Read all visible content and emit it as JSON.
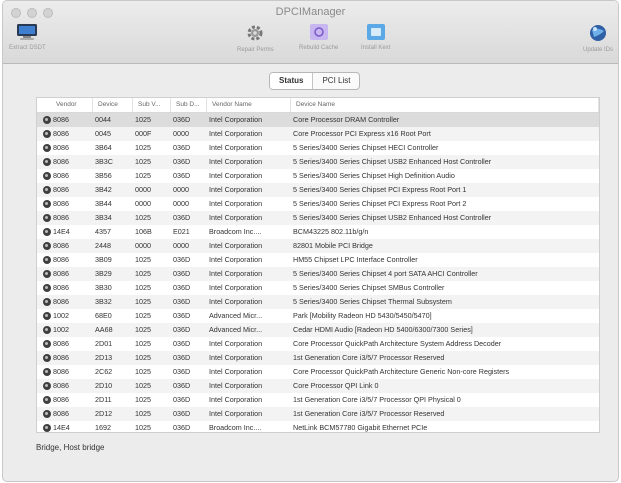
{
  "window": {
    "title": "DPCIManager"
  },
  "toolbar": {
    "extract_dsdt": "Extract DSDT",
    "repair_perms": "Repair Perms",
    "rebuild_cache": "Rebuild Cache",
    "install_kext": "Install Kext",
    "update_ids": "Update IDs"
  },
  "tabs": [
    {
      "label": "Status"
    },
    {
      "label": "PCI List"
    }
  ],
  "table": {
    "headers": {
      "vendor": "Vendor",
      "device": "Device",
      "subv": "Sub V...",
      "subd": "Sub D...",
      "vname": "Vendor Name",
      "dname": "Device Name"
    },
    "rows": [
      {
        "vendor": "8086",
        "device": "0044",
        "subv": "1025",
        "subd": "036D",
        "vname": "Intel Corporation",
        "dname": "Core Processor DRAM Controller"
      },
      {
        "vendor": "8086",
        "device": "0045",
        "subv": "000F",
        "subd": "0000",
        "vname": "Intel Corporation",
        "dname": "Core Processor PCI Express x16 Root Port"
      },
      {
        "vendor": "8086",
        "device": "3B64",
        "subv": "1025",
        "subd": "036D",
        "vname": "Intel Corporation",
        "dname": "5 Series/3400 Series Chipset HECI Controller"
      },
      {
        "vendor": "8086",
        "device": "3B3C",
        "subv": "1025",
        "subd": "036D",
        "vname": "Intel Corporation",
        "dname": "5 Series/3400 Series Chipset USB2 Enhanced Host Controller"
      },
      {
        "vendor": "8086",
        "device": "3B56",
        "subv": "1025",
        "subd": "036D",
        "vname": "Intel Corporation",
        "dname": "5 Series/3400 Series Chipset High Definition Audio"
      },
      {
        "vendor": "8086",
        "device": "3B42",
        "subv": "0000",
        "subd": "0000",
        "vname": "Intel Corporation",
        "dname": "5 Series/3400 Series Chipset PCI Express Root Port 1"
      },
      {
        "vendor": "8086",
        "device": "3B44",
        "subv": "0000",
        "subd": "0000",
        "vname": "Intel Corporation",
        "dname": "5 Series/3400 Series Chipset PCI Express Root Port 2"
      },
      {
        "vendor": "8086",
        "device": "3B34",
        "subv": "1025",
        "subd": "036D",
        "vname": "Intel Corporation",
        "dname": "5 Series/3400 Series Chipset USB2 Enhanced Host Controller"
      },
      {
        "vendor": "14E4",
        "device": "4357",
        "subv": "106B",
        "subd": "E021",
        "vname": "Broadcom Inc....",
        "dname": "BCM43225 802.11b/g/n"
      },
      {
        "vendor": "8086",
        "device": "2448",
        "subv": "0000",
        "subd": "0000",
        "vname": "Intel Corporation",
        "dname": "82801 Mobile PCI Bridge"
      },
      {
        "vendor": "8086",
        "device": "3B09",
        "subv": "1025",
        "subd": "036D",
        "vname": "Intel Corporation",
        "dname": "HM55 Chipset LPC Interface Controller"
      },
      {
        "vendor": "8086",
        "device": "3B29",
        "subv": "1025",
        "subd": "036D",
        "vname": "Intel Corporation",
        "dname": "5 Series/3400 Series Chipset 4 port SATA AHCI Controller"
      },
      {
        "vendor": "8086",
        "device": "3B30",
        "subv": "1025",
        "subd": "036D",
        "vname": "Intel Corporation",
        "dname": "5 Series/3400 Series Chipset SMBus Controller"
      },
      {
        "vendor": "8086",
        "device": "3B32",
        "subv": "1025",
        "subd": "036D",
        "vname": "Intel Corporation",
        "dname": "5 Series/3400 Series Chipset Thermal Subsystem"
      },
      {
        "vendor": "1002",
        "device": "68E0",
        "subv": "1025",
        "subd": "036D",
        "vname": "Advanced Micr...",
        "dname": "Park [Mobility Radeon HD 5430/5450/5470]"
      },
      {
        "vendor": "1002",
        "device": "AA68",
        "subv": "1025",
        "subd": "036D",
        "vname": "Advanced Micr...",
        "dname": "Cedar HDMI Audio [Radeon HD 5400/6300/7300 Series]"
      },
      {
        "vendor": "8086",
        "device": "2D01",
        "subv": "1025",
        "subd": "036D",
        "vname": "Intel Corporation",
        "dname": "Core Processor QuickPath Architecture System Address Decoder"
      },
      {
        "vendor": "8086",
        "device": "2D13",
        "subv": "1025",
        "subd": "036D",
        "vname": "Intel Corporation",
        "dname": "1st Generation Core i3/5/7 Processor Reserved"
      },
      {
        "vendor": "8086",
        "device": "2C62",
        "subv": "1025",
        "subd": "036D",
        "vname": "Intel Corporation",
        "dname": "Core Processor QuickPath Architecture Generic Non-core Registers"
      },
      {
        "vendor": "8086",
        "device": "2D10",
        "subv": "1025",
        "subd": "036D",
        "vname": "Intel Corporation",
        "dname": "Core Processor QPI Link 0"
      },
      {
        "vendor": "8086",
        "device": "2D11",
        "subv": "1025",
        "subd": "036D",
        "vname": "Intel Corporation",
        "dname": "1st Generation Core i3/5/7 Processor QPI Physical 0"
      },
      {
        "vendor": "8086",
        "device": "2D12",
        "subv": "1025",
        "subd": "036D",
        "vname": "Intel Corporation",
        "dname": "1st Generation Core i3/5/7 Processor Reserved"
      },
      {
        "vendor": "14E4",
        "device": "1692",
        "subv": "1025",
        "subd": "036D",
        "vname": "Broadcom Inc....",
        "dname": "NetLink BCM57780 Gigabit Ethernet PCIe"
      }
    ]
  },
  "status_bar": {
    "text": "Bridge, Host bridge"
  },
  "icons": {
    "extract": "monitor-icon",
    "repair": "gear-icon",
    "rebuild": "cache-icon",
    "install": "kext-icon",
    "update": "globe-icon"
  },
  "colors": {
    "accent": "#5aa9e6",
    "rebuild": "#c8b6f0",
    "selected_row": "#dcdcdc"
  }
}
